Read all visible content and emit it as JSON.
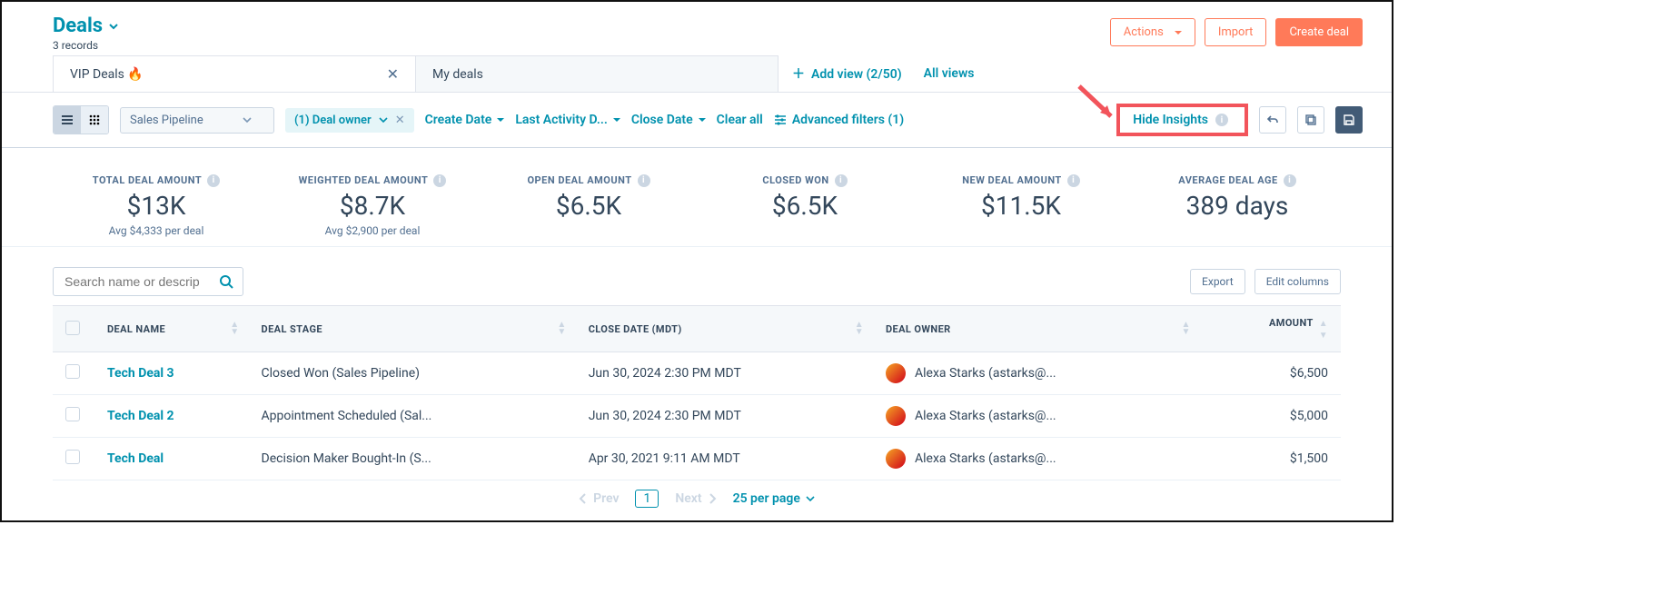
{
  "header": {
    "title": "Deals",
    "record_count": "3 records",
    "actions_label": "Actions",
    "import_label": "Import",
    "create_label": "Create deal"
  },
  "tabs": {
    "active": "VIP Deals 🔥",
    "second": "My deals",
    "add_view": "Add view (2/50)",
    "all_views": "All views"
  },
  "filters": {
    "pipeline": "Sales Pipeline",
    "owner_chip": "(1) Deal owner",
    "create_date": "Create Date",
    "last_activity": "Last Activity D...",
    "close_date": "Close Date",
    "clear_all": "Clear all",
    "advanced": "Advanced filters (1)",
    "hide_insights": "Hide Insights"
  },
  "insights": [
    {
      "label": "TOTAL DEAL AMOUNT",
      "value": "$13K",
      "sub": "Avg $4,333 per deal"
    },
    {
      "label": "WEIGHTED DEAL AMOUNT",
      "value": "$8.7K",
      "sub": "Avg $2,900 per deal"
    },
    {
      "label": "OPEN DEAL AMOUNT",
      "value": "$6.5K",
      "sub": ""
    },
    {
      "label": "CLOSED WON",
      "value": "$6.5K",
      "sub": ""
    },
    {
      "label": "NEW DEAL AMOUNT",
      "value": "$11.5K",
      "sub": ""
    },
    {
      "label": "AVERAGE DEAL AGE",
      "value": "389 days",
      "sub": ""
    }
  ],
  "table": {
    "search_placeholder": "Search name or descrip",
    "export_label": "Export",
    "edit_columns_label": "Edit columns",
    "columns": {
      "name": "DEAL NAME",
      "stage": "DEAL STAGE",
      "close": "CLOSE DATE (MDT)",
      "owner": "DEAL OWNER",
      "amount": "AMOUNT"
    },
    "rows": [
      {
        "name": "Tech Deal 3",
        "stage": "Closed Won (Sales Pipeline)",
        "close": "Jun 30, 2024 2:30 PM MDT",
        "owner": "Alexa Starks (astarks@...",
        "amount": "$6,500"
      },
      {
        "name": "Tech Deal 2",
        "stage": "Appointment Scheduled (Sal...",
        "close": "Jun 30, 2024 2:30 PM MDT",
        "owner": "Alexa Starks (astarks@...",
        "amount": "$5,000"
      },
      {
        "name": "Tech Deal",
        "stage": "Decision Maker Bought-In (S...",
        "close": "Apr 30, 2021 9:11 AM MDT",
        "owner": "Alexa Starks (astarks@...",
        "amount": "$1,500"
      }
    ]
  },
  "pager": {
    "prev": "Prev",
    "page": "1",
    "next": "Next",
    "per_page": "25 per page"
  }
}
